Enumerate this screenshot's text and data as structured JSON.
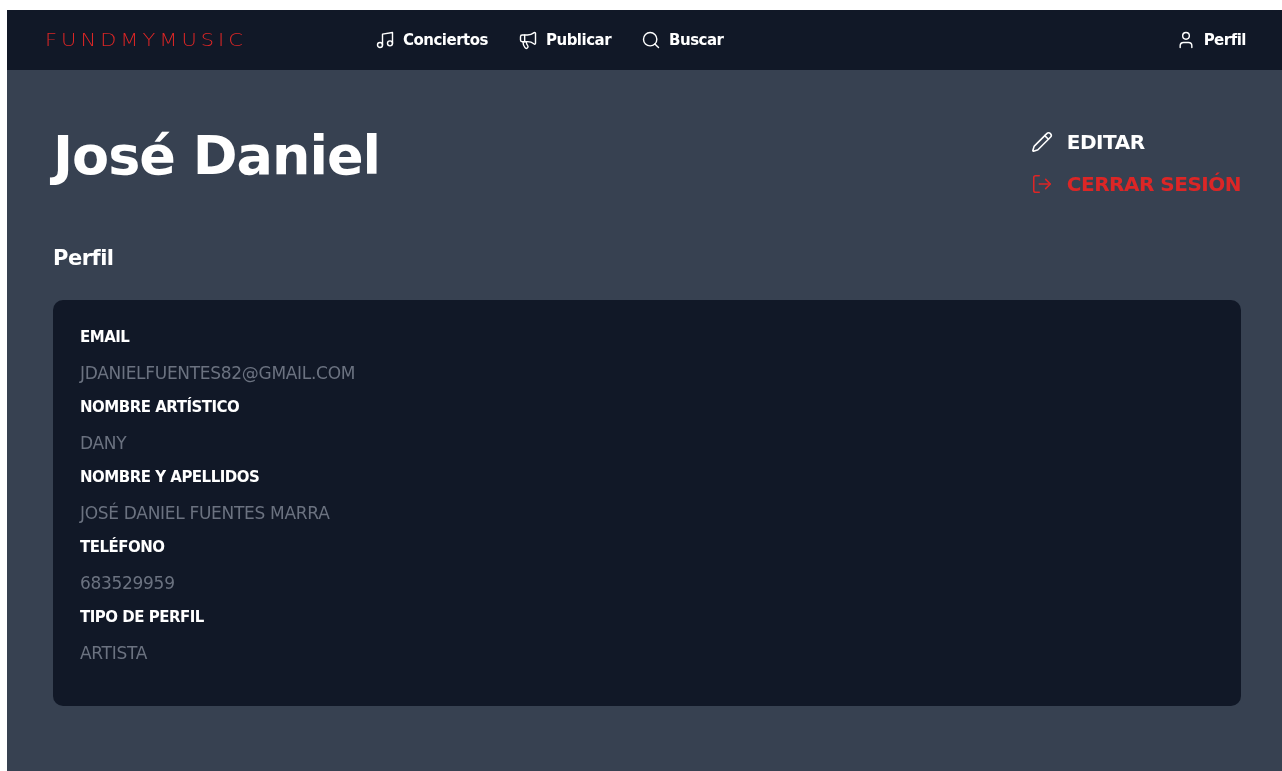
{
  "nav": {
    "logo": "FUNDMYMUSIC",
    "links": [
      {
        "kind": "music",
        "label": "Conciertos"
      },
      {
        "kind": "megaphone",
        "label": "Publicar"
      },
      {
        "kind": "search",
        "label": "Buscar"
      }
    ],
    "profile": {
      "kind": "user",
      "label": "Perfil"
    }
  },
  "title": "José Daniel",
  "actions": [
    {
      "kind": "edit",
      "label": "EDITAR"
    },
    {
      "kind": "logout",
      "label": "CERRAR SESIÓN"
    }
  ],
  "section": "Perfil",
  "fields": [
    {
      "label": "EMAIL",
      "value": "JDANIELFUENTES82@GMAIL.COM"
    },
    {
      "label": "NOMBRE ARTÍSTICO",
      "value": "DANY"
    },
    {
      "label": "NOMBRE Y APELLIDOS",
      "value": "JOSÉ DANIEL FUENTES MARRA"
    },
    {
      "label": "TELÉFONO",
      "value": "683529959"
    },
    {
      "label": "TIPO DE PERFIL",
      "value": "ARTISTA"
    }
  ]
}
